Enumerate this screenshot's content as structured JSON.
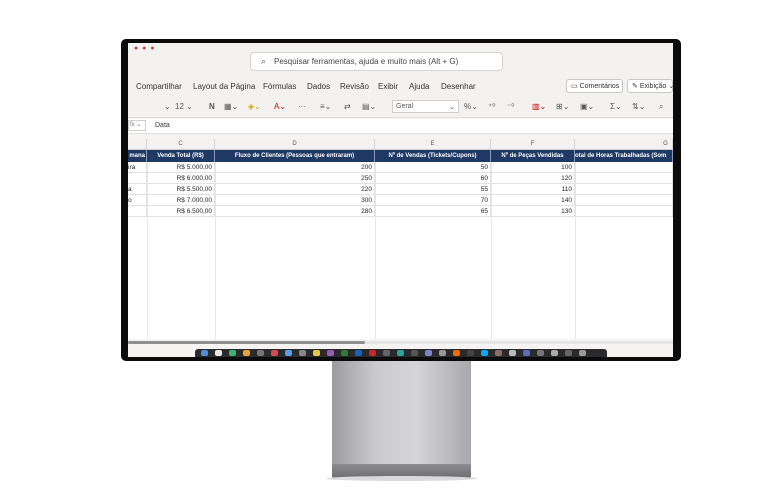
{
  "window": {
    "tab_title": "",
    "search_placeholder": "Pesquisar ferramentas, ajuda e muito mais (Alt + G)"
  },
  "menu": {
    "items": [
      "Compartilhar",
      "Layout da Página",
      "Fórmulas",
      "Dados",
      "Revisão",
      "Exibir",
      "Ajuda",
      "Desenhar"
    ],
    "comments_label": "Comentários",
    "view_label": "Exibição"
  },
  "ribbon": {
    "font_size": "12",
    "bold": "N",
    "number_format": "Geral"
  },
  "formula_bar": {
    "content": "Data"
  },
  "columns": {
    "C": "C",
    "D": "D",
    "E": "E",
    "F": "F",
    "G": "G"
  },
  "headers": {
    "a": "mana",
    "c": "Venda Total (R$)",
    "d": "Fluxo de Clientes (Pessoas que entraram)",
    "e": "Nº de Vendas (Tickets/Cupons)",
    "f": "Nº de Peças Vendidas",
    "g": "otal de Horas Trabalhadas (Som"
  },
  "rows": [
    {
      "a": "ira",
      "c": "R$ 5.000,00",
      "d": "200",
      "e": "50",
      "f": "100"
    },
    {
      "a": "",
      "c": "R$ 6.000,00",
      "d": "250",
      "e": "60",
      "f": "120"
    },
    {
      "a": "a",
      "c": "R$ 5.500,00",
      "d": "220",
      "e": "55",
      "f": "110"
    },
    {
      "a": "o",
      "c": "R$ 7.000,00",
      "d": "300",
      "e": "70",
      "f": "140"
    },
    {
      "a": "",
      "c": "R$ 6.500,00",
      "d": "280",
      "e": "65",
      "f": "130"
    }
  ],
  "colors": {
    "header_bg": "#1f3864",
    "accent": "#c43e1c"
  }
}
